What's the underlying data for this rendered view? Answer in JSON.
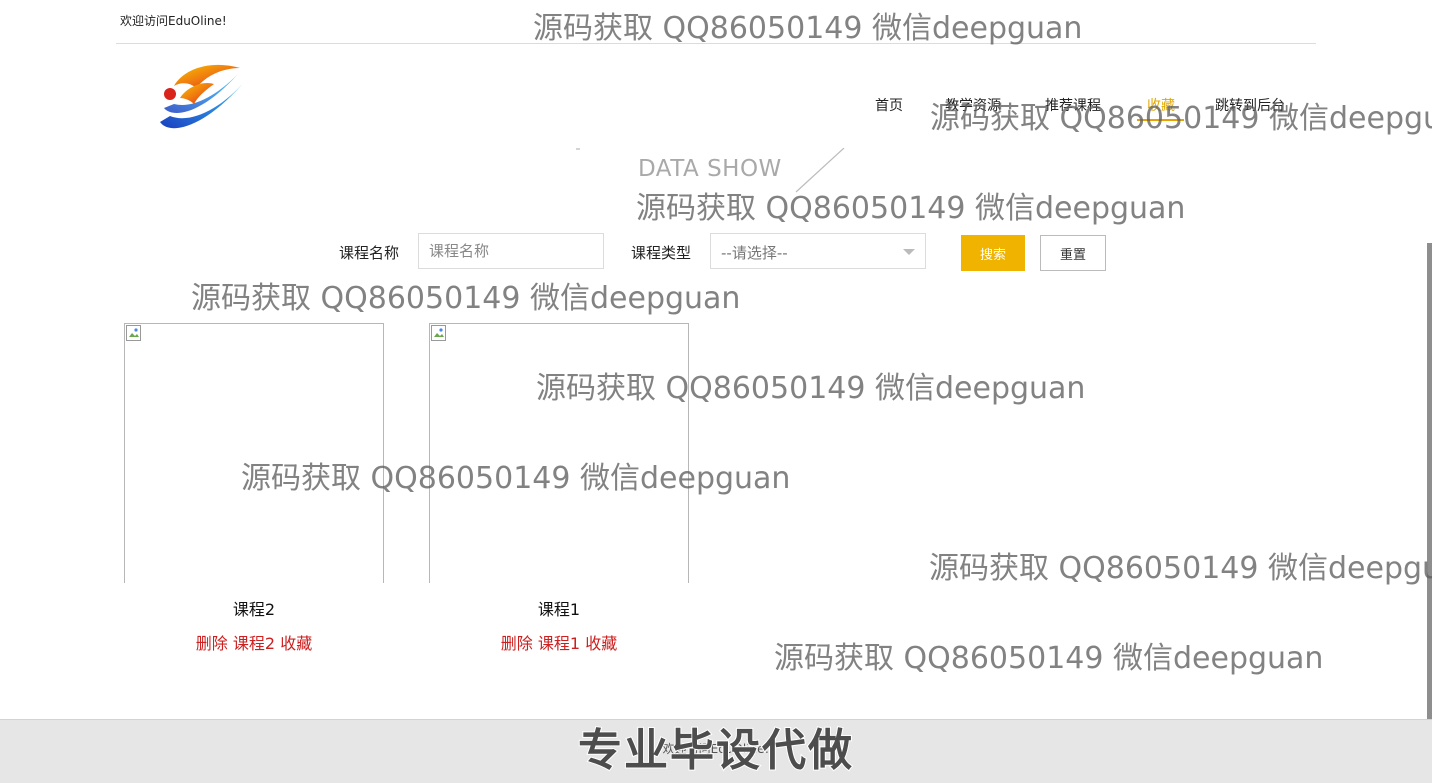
{
  "topbar": {
    "welcome": "欢迎访问EduOline!"
  },
  "nav": {
    "items": [
      {
        "label": "首页"
      },
      {
        "label": "教学资源"
      },
      {
        "label": "推荐课程"
      },
      {
        "label": "收藏",
        "active": true
      },
      {
        "label": "跳转到后台"
      }
    ],
    "accent_color": "#e8a200"
  },
  "section_title": "DATA SHOW",
  "search": {
    "name_label": "课程名称",
    "name_placeholder": "课程名称",
    "type_label": "课程类型",
    "type_selected": "--请选择--",
    "search_button": "搜索",
    "reset_button": "重置",
    "button_color": "#f0b400"
  },
  "cards": [
    {
      "name": "课程2",
      "delete": "删除",
      "course": "课程2",
      "collect": "收藏"
    },
    {
      "name": "课程1",
      "delete": "删除",
      "course": "课程1",
      "collect": "收藏"
    }
  ],
  "footer": {
    "text": "欢迎访问EduOline!",
    "banner": "专业毕设代做"
  },
  "watermarks": [
    "源码获取 QQ86050149 微信deepguan",
    "源码获取 QQ86050149 微信deepguan",
    "源码获取 QQ86050149 微信deepguan",
    "源码获取 QQ86050149 微信deepguan",
    "源码获取 QQ86050149 微信deepguan",
    "源码获取 QQ86050149 微信deepguan",
    "源码获取 QQ86050149 微信deepguan",
    "源码获取 QQ86050149 微信deepguan"
  ]
}
